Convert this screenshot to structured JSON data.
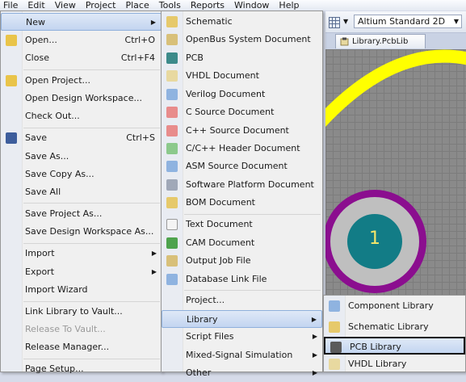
{
  "menubar": {
    "items": [
      "File",
      "Edit",
      "View",
      "Project",
      "Place",
      "Tools",
      "Reports",
      "Window",
      "Help"
    ]
  },
  "toolbar": {
    "view_mode": "Altium Standard 2D"
  },
  "doc_tab": {
    "label": "Library.PcbLib"
  },
  "canvas": {
    "pad_number": "1",
    "colors": {
      "pad_ring": "#8b0e8f",
      "pad_fill": "#bfbfbf",
      "pad_core": "#127c86",
      "track": "#ffff00"
    }
  },
  "file_menu": {
    "items": [
      {
        "label": "New",
        "shortcut": "",
        "arrow": true,
        "highlight": true
      },
      {
        "label": "Open...",
        "shortcut": "Ctrl+O"
      },
      {
        "label": "Close",
        "shortcut": "Ctrl+F4"
      },
      {
        "label": "Open Project..."
      },
      {
        "label": "Open Design Workspace..."
      },
      {
        "label": "Check Out..."
      },
      {
        "label": "Save",
        "shortcut": "Ctrl+S"
      },
      {
        "label": "Save As..."
      },
      {
        "label": "Save Copy As..."
      },
      {
        "label": "Save All"
      },
      {
        "label": "Save Project As..."
      },
      {
        "label": "Save Design Workspace As..."
      },
      {
        "label": "Import",
        "arrow": true
      },
      {
        "label": "Export",
        "arrow": true
      },
      {
        "label": "Import Wizard"
      },
      {
        "label": "Link Library to Vault..."
      },
      {
        "label": "Release To Vault...",
        "disabled": true
      },
      {
        "label": "Release Manager..."
      },
      {
        "label": "Page Setup..."
      }
    ]
  },
  "new_menu": {
    "items": [
      {
        "label": "Schematic"
      },
      {
        "label": "OpenBus System Document"
      },
      {
        "label": "PCB"
      },
      {
        "label": "VHDL Document"
      },
      {
        "label": "Verilog Document"
      },
      {
        "label": "C Source Document"
      },
      {
        "label": "C++ Source Document"
      },
      {
        "label": "C/C++ Header Document"
      },
      {
        "label": "ASM Source Document"
      },
      {
        "label": "Software Platform Document"
      },
      {
        "label": "BOM Document"
      },
      {
        "label": "Text Document"
      },
      {
        "label": "CAM Document"
      },
      {
        "label": "Output Job File"
      },
      {
        "label": "Database Link File"
      },
      {
        "label": "Project..."
      },
      {
        "label": "Library",
        "arrow": true,
        "highlight": true
      },
      {
        "label": "Script Files",
        "arrow": true
      },
      {
        "label": "Mixed-Signal Simulation",
        "arrow": true
      },
      {
        "label": "Other",
        "arrow": true
      }
    ]
  },
  "library_menu": {
    "items": [
      {
        "label": "Component Library"
      },
      {
        "label": "Schematic Library"
      },
      {
        "label": "PCB Library",
        "highlight": true
      },
      {
        "label": "VHDL Library"
      }
    ]
  }
}
